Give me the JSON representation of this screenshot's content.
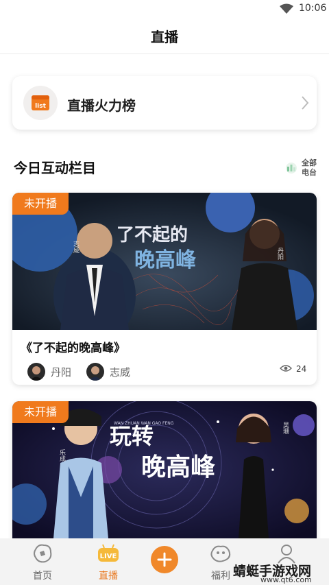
{
  "status_bar": {
    "time": "10:06"
  },
  "header": {
    "title": "直播"
  },
  "rank_card": {
    "label": "直播火力榜",
    "icon": "list-icon"
  },
  "section": {
    "title": "今日互动栏目",
    "all_stations_line1": "全部",
    "all_stations_line2": "电台"
  },
  "programs": [
    {
      "status": "未开播",
      "banner_title_line1": "了不起的",
      "banner_title_line2": "晚高峰",
      "banner_left_name": "志威",
      "banner_right_name": "丹阳",
      "title": "《了不起的晚高峰》",
      "hosts": [
        {
          "name": "丹阳"
        },
        {
          "name": "志威"
        }
      ],
      "views": "24"
    },
    {
      "status": "未开播",
      "banner_title_line1": "玩转",
      "banner_title_line2": "晚高峰",
      "banner_left_name": "乐成",
      "banner_right_name": "吴珊",
      "banner_letters": "WAN ZHUAN WAN GAO FENG"
    }
  ],
  "tabs": [
    {
      "label": "首页",
      "icon": "home-icon"
    },
    {
      "label": "直播",
      "icon": "live-icon",
      "badge": "LIVE"
    },
    {
      "label": "",
      "icon": "plus-icon"
    },
    {
      "label": "福利",
      "icon": "gift-icon"
    },
    {
      "label": "",
      "icon": "profile-icon"
    }
  ],
  "watermark": {
    "text": "蜻蜓手游戏网",
    "url": "www.qt6.com"
  },
  "colors": {
    "accent": "#f07a1d",
    "banner1": "#1c2a3a",
    "banner2": "#1a1638"
  }
}
